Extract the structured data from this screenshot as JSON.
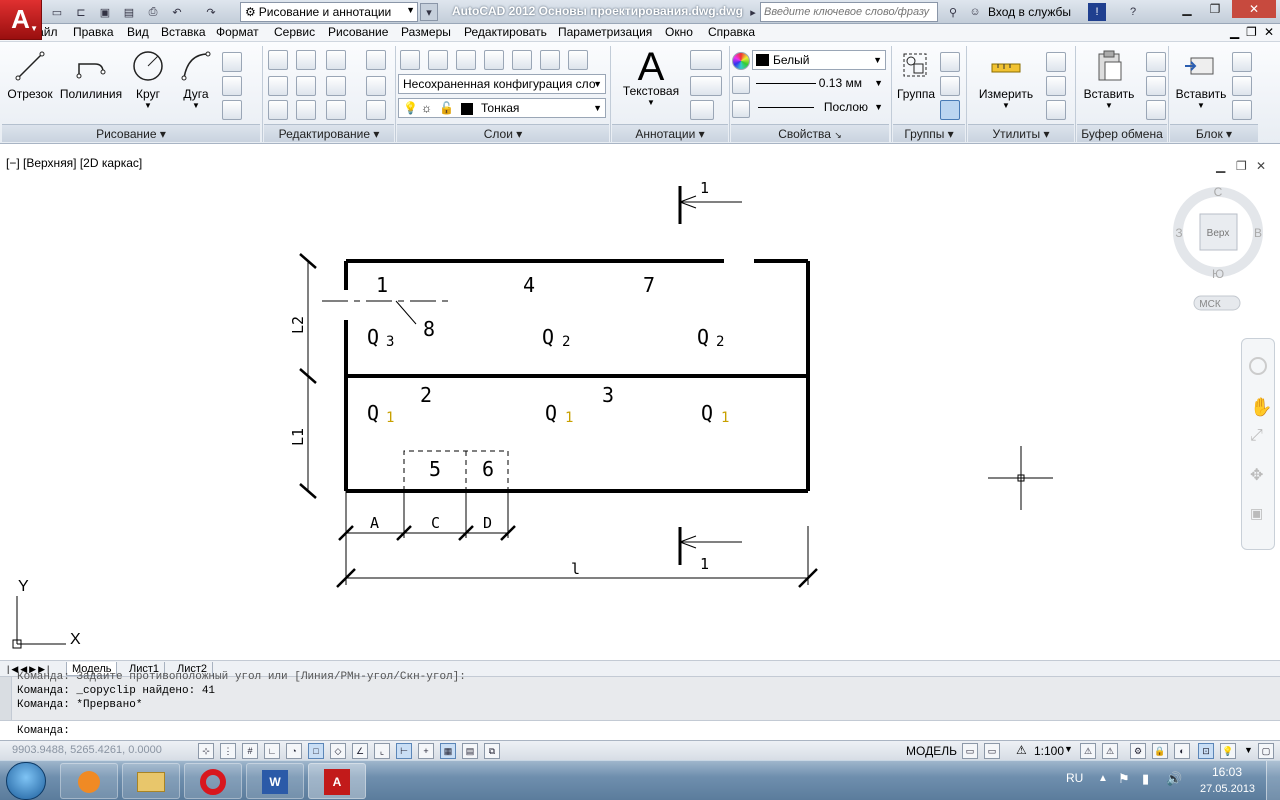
{
  "app": {
    "logo_letter": "A",
    "workspace": "Рисование и аннотации",
    "title": "AutoCAD 2012    Основы проектирования.dwg.dwg",
    "search_placeholder": "Введите ключевое слово/фразу",
    "login": "Вход в службы"
  },
  "menu": [
    "Файл",
    "Правка",
    "Вид",
    "Вставка",
    "Формат",
    "Сервис",
    "Рисование",
    "Размеры",
    "Редактировать",
    "Параметризация",
    "Окно",
    "Справка"
  ],
  "ribbon": {
    "draw": {
      "title": "Рисование",
      "line": "Отрезок",
      "polyline": "Полилиния",
      "circle": "Круг",
      "arc": "Дуга"
    },
    "edit": {
      "title": "Редактирование"
    },
    "layers": {
      "title": "Слои",
      "layer_state": "Несохраненная конфигурация сло",
      "current_layer": "Тонкая"
    },
    "annotations": {
      "title": "Аннотации",
      "text": "Текстовая"
    },
    "properties": {
      "title": "Свойства",
      "color": "Белый",
      "lineweight": "0.13 мм",
      "linetype": "Послою"
    },
    "groups": {
      "title": "Группы",
      "group": "Группа"
    },
    "utilities": {
      "title": "Утилиты",
      "measure": "Измерить"
    },
    "clipboard": {
      "title": "Буфер обмена",
      "paste": "Вставить"
    },
    "block": {
      "title": "Блок",
      "insert": "Вставить"
    }
  },
  "viewport": {
    "label": "[−] [Верхняя] [2D каркас]",
    "viewcube": {
      "top": "Верх",
      "north": "С",
      "south": "Ю",
      "west": "З",
      "east": "В",
      "ucs": "МСК"
    }
  },
  "drawing": {
    "labels": {
      "room1": "1",
      "room2": "2",
      "room3": "3",
      "room4": "4",
      "room5": "5",
      "room6": "6",
      "room7": "7",
      "callout8": "8",
      "q3": "Q",
      "q3sub": "3",
      "q2a": "Q",
      "q2asub": "2",
      "q2b": "Q",
      "q2bsub": "2",
      "q1a": "Q",
      "q1asub": "1",
      "q1b": "Q",
      "q1bsub": "1",
      "q1c": "Q",
      "q1csub": "1",
      "dimL2": "L2",
      "dimL1": "L1",
      "dimA": "A",
      "dimC": "C",
      "dimD": "D",
      "diml": "l",
      "section_top": "1",
      "section_bottom": "1",
      "axis_y": "Y",
      "axis_x": "X"
    }
  },
  "tabs": [
    "Модель",
    "Лист1",
    "Лист2"
  ],
  "command": {
    "history": [
      "Команда: _copyclip найдено: 41",
      "Команда: *Прервано*"
    ],
    "prompt": "Команда:"
  },
  "status": {
    "coords": "9903.9488, 5265.4261, 0.0000",
    "model": "МОДЕЛЬ",
    "scale": "1:100"
  },
  "taskbar": {
    "lang": "RU",
    "time": "16:03",
    "date": "27.05.2013"
  }
}
